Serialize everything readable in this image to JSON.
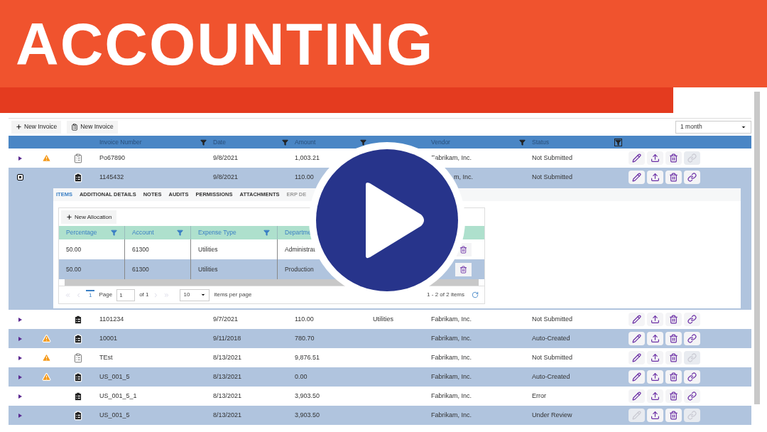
{
  "banner": {
    "title": "ACCOUNTING"
  },
  "toolbar": {
    "buttons": [
      {
        "label": "New Invoice",
        "kind": "plus"
      },
      {
        "label": "New Invoice",
        "kind": "document"
      }
    ],
    "period": {
      "value": "1 month"
    }
  },
  "table": {
    "columns": [
      "Invoice Number",
      "Date",
      "Amount",
      "",
      "Vendor",
      "Status"
    ],
    "rows": [
      {
        "warning": true,
        "document_filled": false,
        "invoice": "Po67890",
        "date": "9/8/2021",
        "amount": "1,003.21",
        "column_4": "",
        "vendor": "Fabrikam, Inc.",
        "status": "Not Submitted",
        "expanded": false,
        "actions": {
          "edit": true,
          "upload": true,
          "delete": true,
          "link": false
        }
      },
      {
        "warning": false,
        "document_filled": true,
        "invoice": "1145432",
        "date": "9/8/2021",
        "amount": "110.00",
        "column_4": "",
        "vendor": "m, Inc.",
        "status": "Not Submitted",
        "expanded": true,
        "actions": {
          "edit": true,
          "upload": true,
          "delete": true,
          "link": true
        }
      },
      {
        "warning": false,
        "document_filled": true,
        "invoice": "1101234",
        "date": "9/7/2021",
        "amount": "110.00",
        "column_4": "Utilities",
        "vendor": "Fabrikam, Inc.",
        "status": "Not Submitted",
        "expanded": false,
        "actions": {
          "edit": true,
          "upload": true,
          "delete": true,
          "link": true
        }
      },
      {
        "warning": true,
        "document_filled": true,
        "invoice": "10001",
        "date": "9/11/2018",
        "amount": "780.70",
        "column_4": "",
        "vendor": "Fabrikam, Inc.",
        "status": "Auto-Created",
        "expanded": false,
        "actions": {
          "edit": true,
          "upload": true,
          "delete": true,
          "link": true
        }
      },
      {
        "warning": true,
        "document_filled": false,
        "invoice": "TEst",
        "date": "8/13/2021",
        "amount": "9,876.51",
        "column_4": "",
        "vendor": "Fabrikam, Inc.",
        "status": "Not Submitted",
        "expanded": false,
        "actions": {
          "edit": true,
          "upload": true,
          "delete": true,
          "link": false
        }
      },
      {
        "warning": true,
        "document_filled": true,
        "invoice": "US_001_5",
        "date": "8/13/2021",
        "amount": "0.00",
        "column_4": "",
        "vendor": "Fabrikam, Inc.",
        "status": "Auto-Created",
        "expanded": false,
        "actions": {
          "edit": true,
          "upload": true,
          "delete": true,
          "link": true
        }
      },
      {
        "warning": false,
        "document_filled": true,
        "invoice": "US_001_5_1",
        "date": "8/13/2021",
        "amount": "3,903.50",
        "column_4": "",
        "vendor": "Fabrikam, Inc.",
        "status": "Error",
        "expanded": false,
        "actions": {
          "edit": true,
          "upload": true,
          "delete": true,
          "link": true
        }
      },
      {
        "warning": false,
        "document_filled": true,
        "invoice": "US_001_5",
        "date": "8/13/2021",
        "amount": "3,903.50",
        "column_4": "",
        "vendor": "Fabrikam, Inc.",
        "status": "Under Review",
        "expanded": false,
        "actions": {
          "edit": false,
          "upload": true,
          "delete": true,
          "link": false
        }
      }
    ]
  },
  "details": {
    "tabs": [
      {
        "label": "ITEMS",
        "selected": true,
        "disabled": false
      },
      {
        "label": "ADDITIONAL DETAILS",
        "selected": false,
        "disabled": false
      },
      {
        "label": "NOTES",
        "selected": false,
        "disabled": false
      },
      {
        "label": "AUDITS",
        "selected": false,
        "disabled": false
      },
      {
        "label": "PERMISSIONS",
        "selected": false,
        "disabled": false
      },
      {
        "label": "ATTACHMENTS",
        "selected": false,
        "disabled": false
      },
      {
        "label": "ERP DE",
        "selected": false,
        "disabled": true
      }
    ],
    "new_button": "New Allocation",
    "columns": [
      "Percentage",
      "Account",
      "Expense Type",
      "Departme"
    ],
    "rows": [
      {
        "cells": [
          "50.00",
          "61300",
          "Utilities",
          "Administrat"
        ]
      },
      {
        "cells": [
          "50.00",
          "61300",
          "Utilities",
          "Production"
        ]
      }
    ],
    "pager": {
      "page": "1",
      "page_label": "Page",
      "page_input": "1",
      "of": "of 1",
      "per_page": "10",
      "per_page_label": "items per page",
      "summary": "1 - 2 of 2 items"
    }
  }
}
